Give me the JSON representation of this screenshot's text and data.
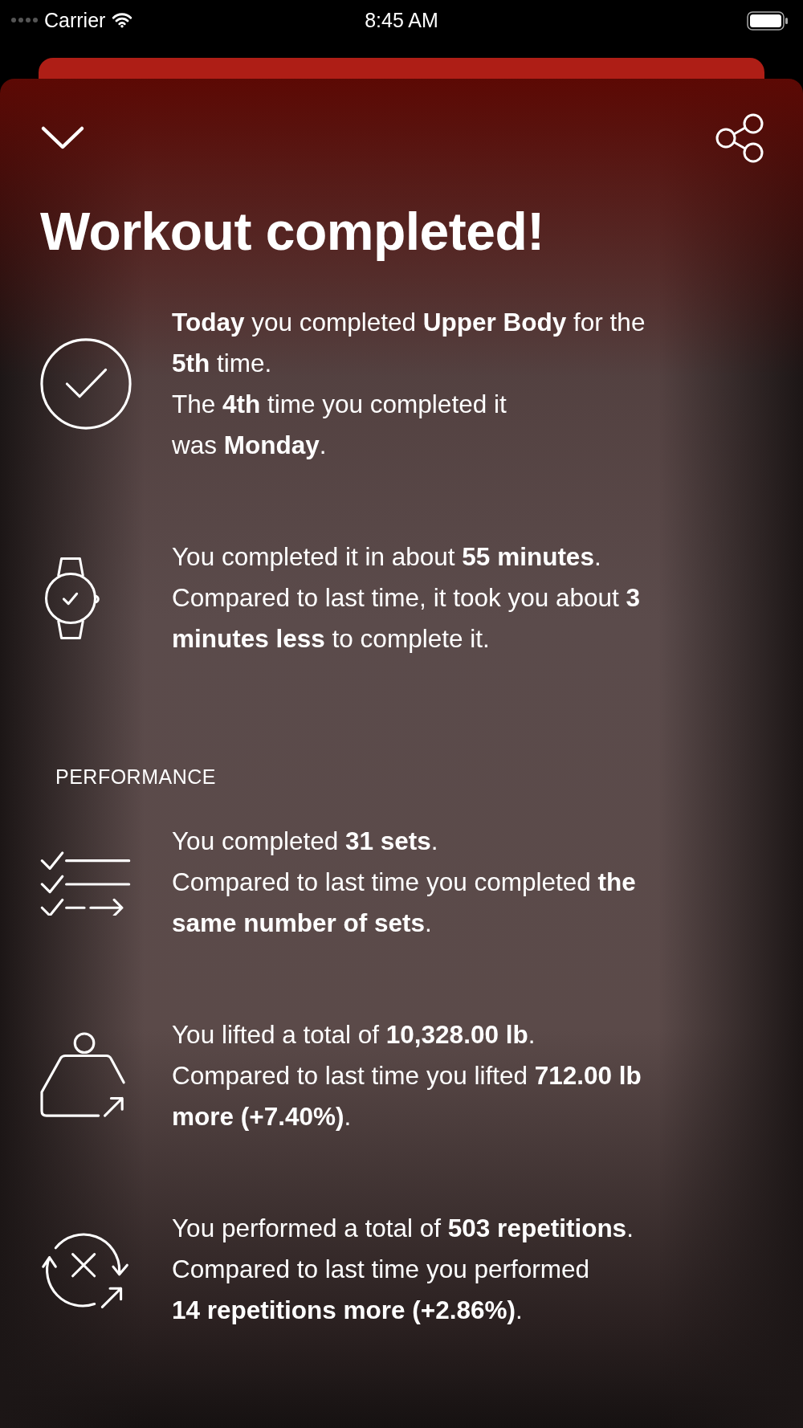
{
  "status_bar": {
    "carrier": "Carrier",
    "time": "8:45 AM"
  },
  "title": "Workout completed!",
  "summary": [
    {
      "kind": "check",
      "lines": [
        "**Today** you completed **Upper Body** for the",
        "**5th** time.",
        "The **4th** time you completed it",
        "was **Monday**."
      ]
    },
    {
      "kind": "watch",
      "lines": [
        "You completed it in about **55 minutes**.",
        "Compared to last time, it took you about **3**",
        "**minutes less** to complete it."
      ]
    }
  ],
  "performance": {
    "heading": "PERFORMANCE",
    "items": [
      {
        "kind": "sets",
        "lines": [
          "You completed **31 sets**.",
          "Compared to last time you completed **the**",
          "**same number of sets**."
        ]
      },
      {
        "kind": "weight",
        "lines": [
          "You lifted a total of **10,328.00 lb**.",
          "Compared to last time you lifted **712.00 lb**",
          "**more (+7.40%)**."
        ]
      },
      {
        "kind": "reps",
        "lines": [
          "You performed a total of **503 repetitions**.",
          "Compared to last time you performed",
          "**14 repetitions more (+2.86%)**."
        ]
      }
    ]
  }
}
